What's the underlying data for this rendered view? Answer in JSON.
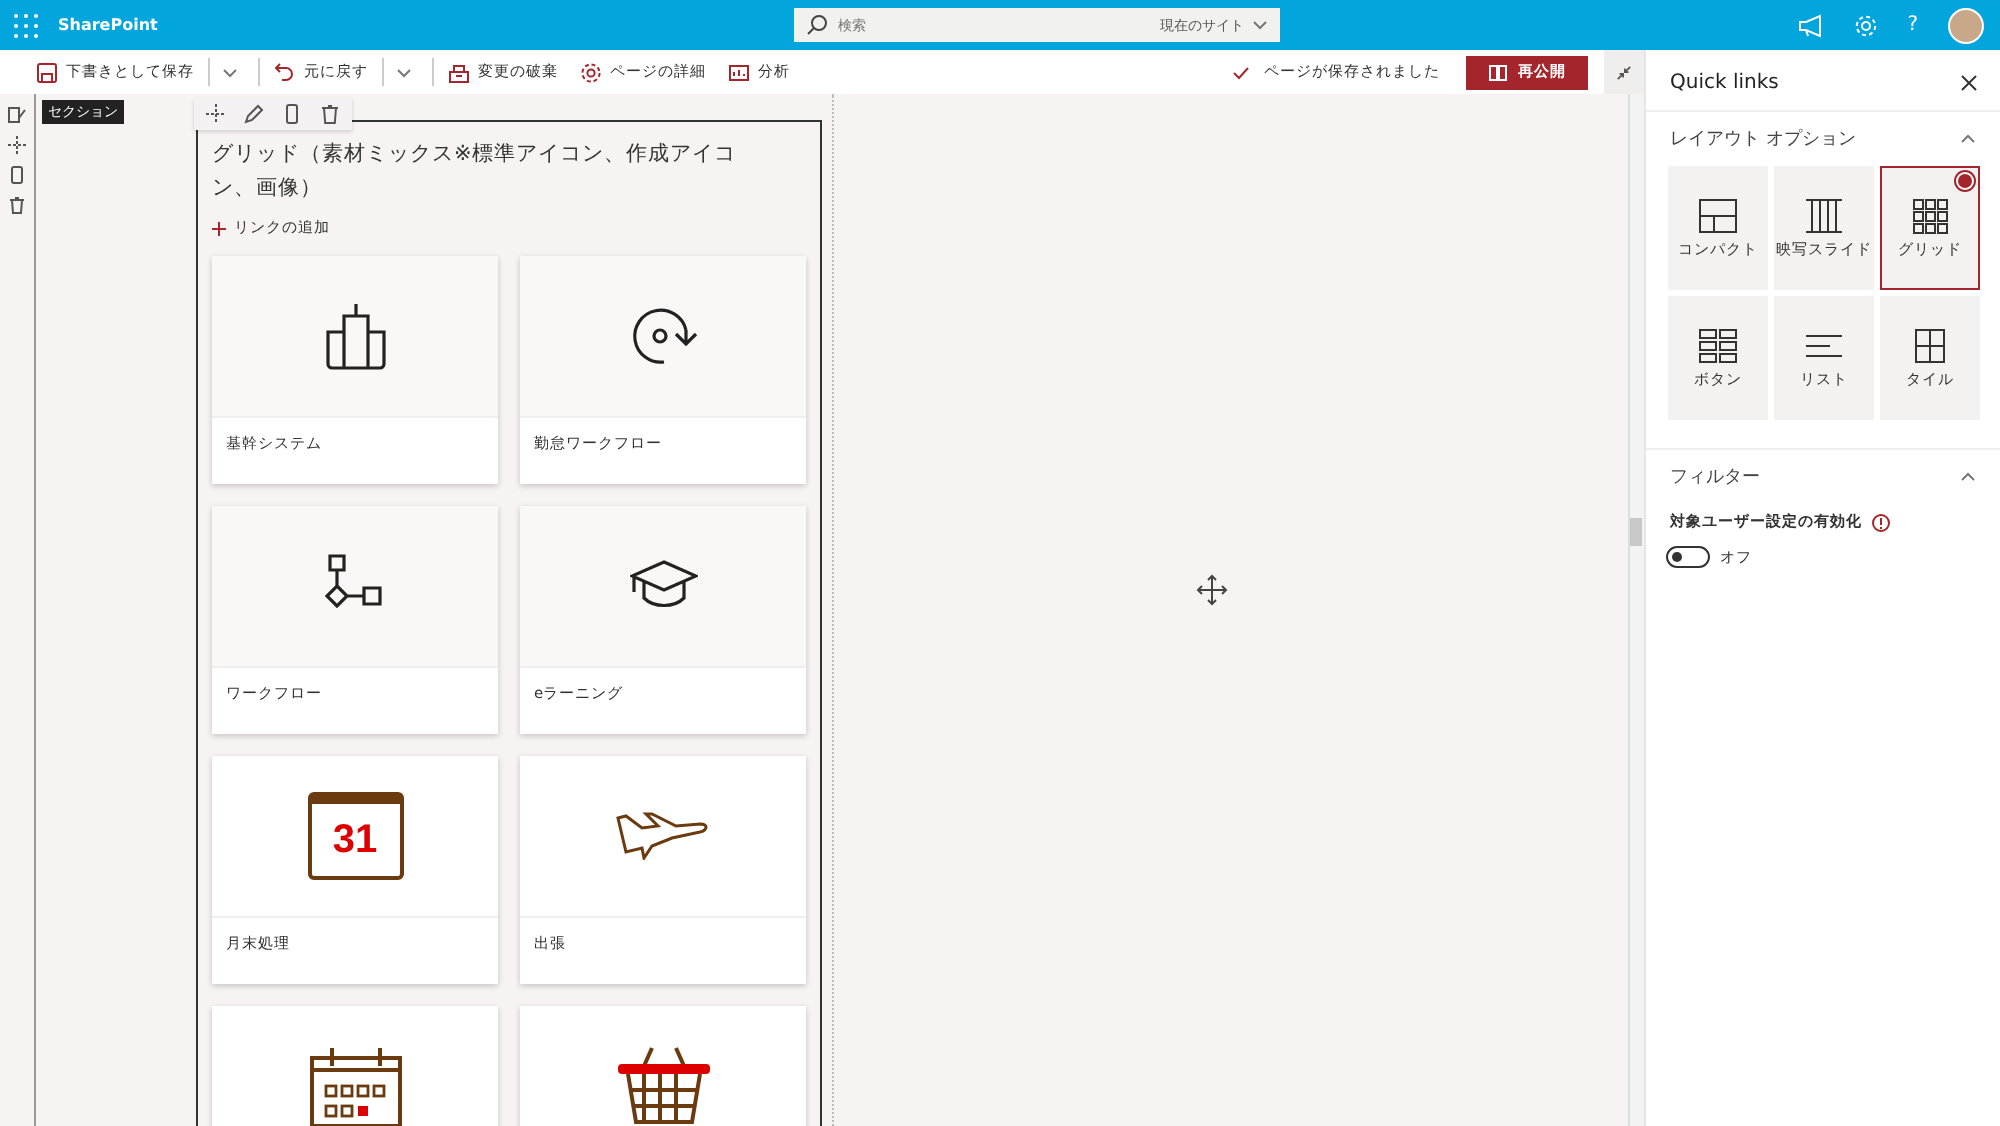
{
  "suite_bar": {
    "app_name": "SharePoint",
    "search": {
      "placeholder": "検索",
      "scope": "現在のサイト"
    },
    "help": "?"
  },
  "command_bar": {
    "items": [
      {
        "label": "下書きとして保存",
        "kind": "save",
        "has_menu": true
      },
      {
        "label": "元に戻す",
        "kind": "undo",
        "has_menu": true
      },
      {
        "label": "変更の破棄",
        "kind": "discard",
        "has_menu": false
      },
      {
        "label": "ページの詳細",
        "kind": "gear",
        "has_menu": false
      },
      {
        "label": "分析",
        "kind": "chart",
        "has_menu": false
      }
    ],
    "status": "ページが保存されました",
    "publish_button": "再公開"
  },
  "canvas": {
    "section_label": "セクション",
    "webpart": {
      "title": "グリッド（素材ミックス※標準アイコン、作成アイコン、画像）",
      "add_link": "リンクの追加",
      "tiles": [
        {
          "kind": "building",
          "label": "基幹システム"
        },
        {
          "kind": "rotate",
          "label": "勤怠ワークフロー"
        },
        {
          "kind": "workflow",
          "label": "ワークフロー"
        },
        {
          "kind": "graduation",
          "label": "eラーニング"
        },
        {
          "kind": "calendar",
          "icon_text": "31",
          "label": "月末処理"
        },
        {
          "kind": "airplane",
          "label": "出張"
        },
        {
          "kind": "schedule"
        },
        {
          "kind": "basket"
        }
      ]
    }
  },
  "panel": {
    "title": "Quick links",
    "layout_section": {
      "title": "レイアウト オプション",
      "expanded": true,
      "options": [
        {
          "kind": "compact",
          "label": "コンパクト",
          "selected": false
        },
        {
          "kind": "filmstrip",
          "label": "映写スライド",
          "selected": false
        },
        {
          "kind": "grid",
          "label": "グリッド",
          "selected": true
        },
        {
          "kind": "button",
          "label": "ボタン",
          "selected": false
        },
        {
          "kind": "list",
          "label": "リスト",
          "selected": false
        },
        {
          "kind": "tile",
          "label": "タイル",
          "selected": false
        }
      ]
    },
    "filter_section": {
      "title": "フィルター",
      "expanded": true,
      "audience_label": "対象ユーザー設定の有効化",
      "toggle": {
        "on": false,
        "label": "オフ"
      }
    }
  }
}
